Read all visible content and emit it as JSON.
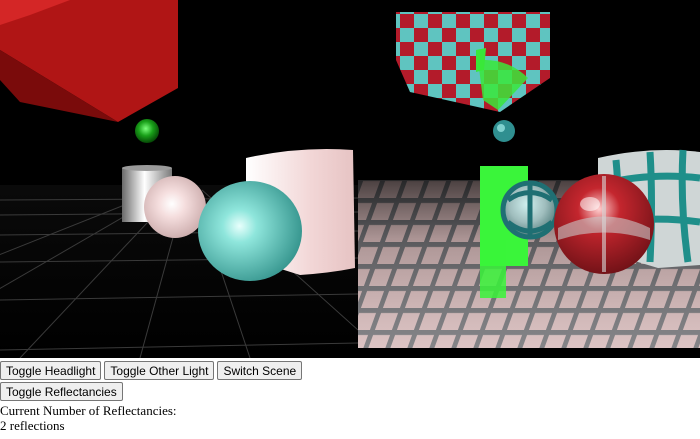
{
  "buttons": {
    "headlight": "Toggle Headlight",
    "other_light": "Toggle Other Light",
    "switch_scene": "Switch Scene",
    "reflectancies": "Toggle Reflectancies"
  },
  "status": {
    "label": "Current Number of Reflectancies:",
    "value": "2 reflections"
  }
}
